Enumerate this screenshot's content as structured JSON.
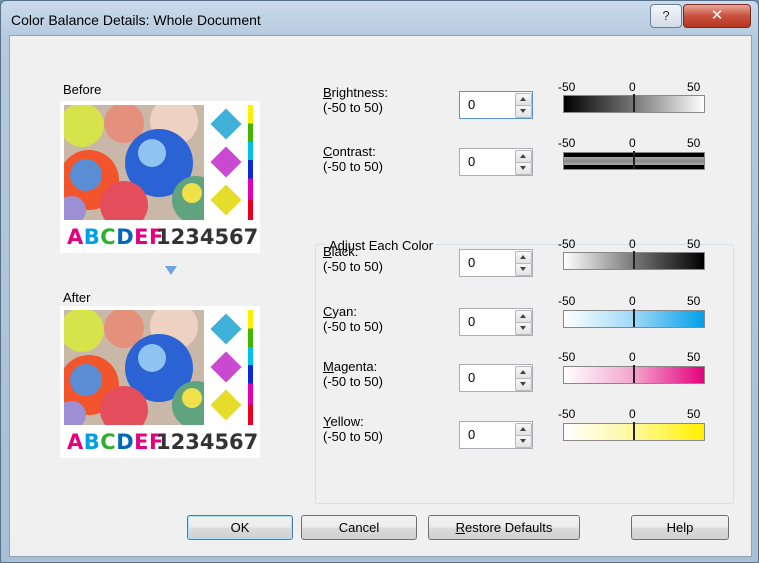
{
  "window": {
    "title": "Color Balance Details: Whole Document",
    "help_glyph": "?",
    "close_glyph": "✕"
  },
  "preview": {
    "before_label": "Before",
    "after_label": "After",
    "sample_letters": [
      "A",
      "B",
      "C",
      "D",
      "E",
      "F"
    ],
    "letter_colors": [
      "#e5007f",
      "#00a0e9",
      "#e5007f",
      "#00a0e9",
      "#e5007f",
      "#e5007f"
    ],
    "sample_numbers": "1234567"
  },
  "adjustments": {
    "brightness": {
      "label_char": "B",
      "label_rest": "rightness:",
      "range": "(-50 to 50)",
      "value": "0"
    },
    "contrast": {
      "label_char": "C",
      "label_rest": "ontrast:",
      "range": "(-50 to 50)",
      "value": "0"
    }
  },
  "color_group": {
    "title": "Adjust Each Color",
    "black": {
      "label_char": "B",
      "label_rest": "lack:",
      "range": "(-50 to 50)",
      "value": "0",
      "color": "#111111"
    },
    "cyan": {
      "label_char": "C",
      "label_rest": "yan:",
      "range": "(-50 to 50)",
      "value": "0",
      "color": "#00a0e9"
    },
    "magenta": {
      "label_char": "M",
      "label_rest": "agenta:",
      "range": "(-50 to 50)",
      "value": "0",
      "color": "#e5007f"
    },
    "yellow": {
      "label_char": "Y",
      "label_rest": "ellow:",
      "range": "(-50 to 50)",
      "value": "0",
      "color": "#fff100"
    }
  },
  "scale": {
    "min": "-50",
    "mid": "0",
    "max": "50"
  },
  "buttons": {
    "ok": "OK",
    "cancel": "Cancel",
    "restore_char": "R",
    "restore_rest": "estore Defaults",
    "help": "Help"
  }
}
